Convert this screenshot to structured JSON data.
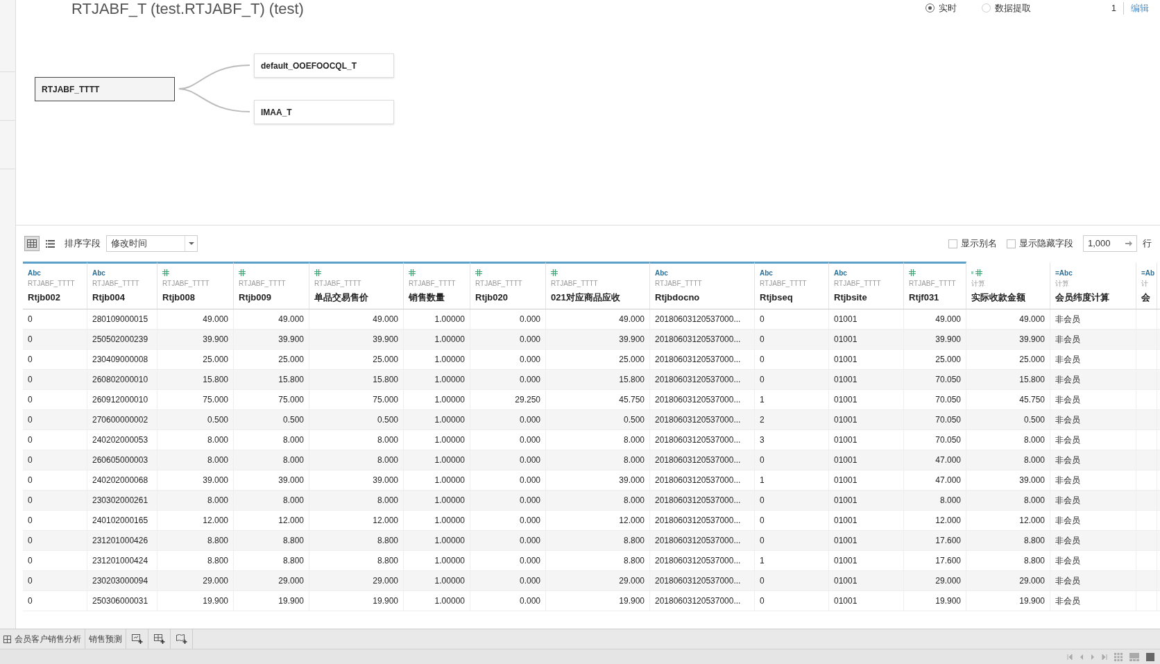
{
  "title": "RTJABF_T (test.RTJABF_T) (test)",
  "connection": {
    "options": [
      {
        "label": "实时",
        "selected": true
      },
      {
        "label": "数据提取",
        "selected": false
      }
    ],
    "count": "1",
    "edit": "编辑"
  },
  "diagram": {
    "primary": "RTJABF_TTTT",
    "joined": [
      "default_OOEFOOCQL_T",
      "IMAA_T"
    ]
  },
  "toolbar": {
    "views": [
      {
        "kind": "grid",
        "selected": true
      },
      {
        "kind": "list",
        "selected": false
      }
    ],
    "sort_label": "排序字段",
    "sort_value": "修改时间",
    "options": [
      {
        "label": "显示别名",
        "checked": false
      },
      {
        "label": "显示隐藏字段",
        "checked": false
      }
    ],
    "row_limit": "1,000",
    "row_unit": "行"
  },
  "table": {
    "columns": [
      {
        "kind": "text",
        "type_label": "Abc",
        "source": "RTJABF_TTTT",
        "name": "Rtjb002"
      },
      {
        "kind": "text",
        "type_label": "Abc",
        "source": "RTJABF_TTTT",
        "name": "Rtjb004"
      },
      {
        "kind": "number",
        "source": "RTJABF_TTTT",
        "name": "Rtjb008"
      },
      {
        "kind": "number",
        "source": "RTJABF_TTTT",
        "name": "Rtjb009"
      },
      {
        "kind": "number",
        "source": "RTJABF_TTTT",
        "name": "单品交易售价"
      },
      {
        "kind": "number",
        "source": "RTJABF_TTTT",
        "name": "销售数量"
      },
      {
        "kind": "number",
        "source": "RTJABF_TTTT",
        "name": "Rtjb020"
      },
      {
        "kind": "number",
        "source": "RTJABF_TTTT",
        "name": "021对应商品应收"
      },
      {
        "kind": "text",
        "type_label": "Abc",
        "source": "RTJABF_TTTT",
        "name": "Rtjbdocno"
      },
      {
        "kind": "text",
        "type_label": "Abc",
        "source": "RTJABF_TTTT",
        "name": "Rtjbseq"
      },
      {
        "kind": "text",
        "type_label": "Abc",
        "source": "RTJABF_TTTT",
        "name": "Rtjbsite"
      },
      {
        "kind": "number",
        "source": "RTJABF_TTTT",
        "name": "Rtjf031"
      },
      {
        "kind": "calc-number",
        "source": "计算",
        "name": "实际收款金额"
      },
      {
        "kind": "calc-text",
        "type_label": "=Abc",
        "source": "计算",
        "name": "会员纬度计算"
      },
      {
        "kind": "calc-text",
        "type_label": "=Ab",
        "source": "计",
        "name": "会"
      }
    ],
    "rows": [
      [
        "0",
        "280109000015",
        "49.000",
        "49.000",
        "49.000",
        "1.00000",
        "0.000",
        "49.000",
        "20180603120537000...",
        "0",
        "01001",
        "49.000",
        "49.000",
        "非会员"
      ],
      [
        "0",
        "250502000239",
        "39.900",
        "39.900",
        "39.900",
        "1.00000",
        "0.000",
        "39.900",
        "20180603120537000...",
        "0",
        "01001",
        "39.900",
        "39.900",
        "非会员"
      ],
      [
        "0",
        "230409000008",
        "25.000",
        "25.000",
        "25.000",
        "1.00000",
        "0.000",
        "25.000",
        "20180603120537000...",
        "0",
        "01001",
        "25.000",
        "25.000",
        "非会员"
      ],
      [
        "0",
        "260802000010",
        "15.800",
        "15.800",
        "15.800",
        "1.00000",
        "0.000",
        "15.800",
        "20180603120537000...",
        "0",
        "01001",
        "70.050",
        "15.800",
        "非会员"
      ],
      [
        "0",
        "260912000010",
        "75.000",
        "75.000",
        "75.000",
        "1.00000",
        "29.250",
        "45.750",
        "20180603120537000...",
        "1",
        "01001",
        "70.050",
        "45.750",
        "非会员"
      ],
      [
        "0",
        "270600000002",
        "0.500",
        "0.500",
        "0.500",
        "1.00000",
        "0.000",
        "0.500",
        "20180603120537000...",
        "2",
        "01001",
        "70.050",
        "0.500",
        "非会员"
      ],
      [
        "0",
        "240202000053",
        "8.000",
        "8.000",
        "8.000",
        "1.00000",
        "0.000",
        "8.000",
        "20180603120537000...",
        "3",
        "01001",
        "70.050",
        "8.000",
        "非会员"
      ],
      [
        "0",
        "260605000003",
        "8.000",
        "8.000",
        "8.000",
        "1.00000",
        "0.000",
        "8.000",
        "20180603120537000...",
        "0",
        "01001",
        "47.000",
        "8.000",
        "非会员"
      ],
      [
        "0",
        "240202000068",
        "39.000",
        "39.000",
        "39.000",
        "1.00000",
        "0.000",
        "39.000",
        "20180603120537000...",
        "1",
        "01001",
        "47.000",
        "39.000",
        "非会员"
      ],
      [
        "0",
        "230302000261",
        "8.000",
        "8.000",
        "8.000",
        "1.00000",
        "0.000",
        "8.000",
        "20180603120537000...",
        "0",
        "01001",
        "8.000",
        "8.000",
        "非会员"
      ],
      [
        "0",
        "240102000165",
        "12.000",
        "12.000",
        "12.000",
        "1.00000",
        "0.000",
        "12.000",
        "20180603120537000...",
        "0",
        "01001",
        "12.000",
        "12.000",
        "非会员"
      ],
      [
        "0",
        "231201000426",
        "8.800",
        "8.800",
        "8.800",
        "1.00000",
        "0.000",
        "8.800",
        "20180603120537000...",
        "0",
        "01001",
        "17.600",
        "8.800",
        "非会员"
      ],
      [
        "0",
        "231201000424",
        "8.800",
        "8.800",
        "8.800",
        "1.00000",
        "0.000",
        "8.800",
        "20180603120537000...",
        "1",
        "01001",
        "17.600",
        "8.800",
        "非会员"
      ],
      [
        "0",
        "230203000094",
        "29.000",
        "29.000",
        "29.000",
        "1.00000",
        "0.000",
        "29.000",
        "20180603120537000...",
        "0",
        "01001",
        "29.000",
        "29.000",
        "非会员"
      ],
      [
        "0",
        "250306000031",
        "19.900",
        "19.900",
        "19.900",
        "1.00000",
        "0.000",
        "19.900",
        "20180603120537000...",
        "0",
        "01001",
        "19.900",
        "19.900",
        "非会员"
      ]
    ]
  },
  "sheet_tabs": [
    {
      "kind": "dashboard",
      "label": "会员客户销售分析"
    },
    {
      "kind": "sheet",
      "label": "销售预测"
    }
  ],
  "new_buttons": [
    {
      "kind": "new-sheet"
    },
    {
      "kind": "new-dashboard"
    },
    {
      "kind": "new-story"
    }
  ]
}
